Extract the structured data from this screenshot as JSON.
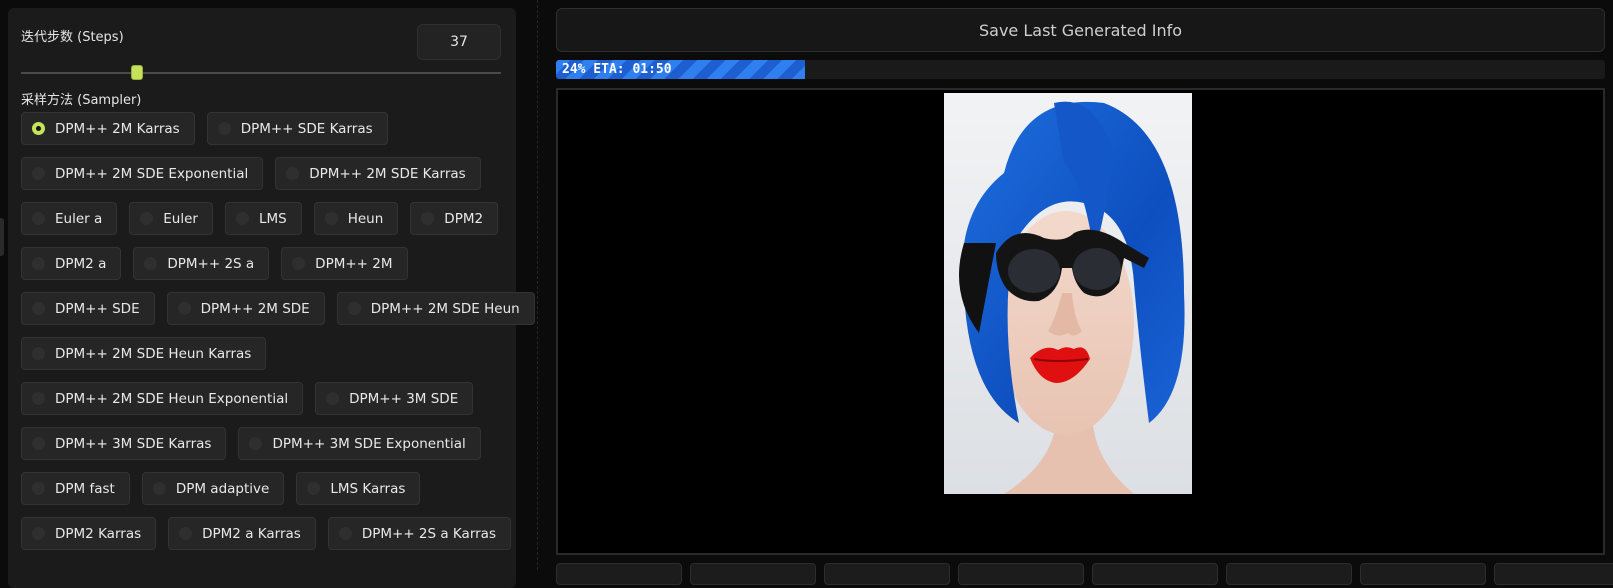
{
  "steps": {
    "label": "迭代步数 (Steps)",
    "value": "37",
    "min": 1,
    "max": 150
  },
  "sampler": {
    "label": "采样方法 (Sampler)",
    "selected": "DPM++ 2M Karras",
    "rows": [
      [
        "DPM++ 2M Karras",
        "DPM++ SDE Karras"
      ],
      [
        "DPM++ 2M SDE Exponential",
        "DPM++ 2M SDE Karras"
      ],
      [
        "Euler a",
        "Euler",
        "LMS",
        "Heun",
        "DPM2"
      ],
      [
        "DPM2 a",
        "DPM++ 2S a",
        "DPM++ 2M"
      ],
      [
        "DPM++ SDE",
        "DPM++ 2M SDE",
        "DPM++ 2M SDE Heun"
      ],
      [
        "DPM++ 2M SDE Heun Karras"
      ],
      [
        "DPM++ 2M SDE Heun Exponential",
        "DPM++ 3M SDE"
      ],
      [
        "DPM++ 3M SDE Karras",
        "DPM++ 3M SDE Exponential"
      ],
      [
        "DPM fast",
        "DPM adaptive",
        "LMS Karras"
      ],
      [
        "DPM2 Karras",
        "DPM2 a Karras",
        "DPM++ 2S a Karras"
      ]
    ]
  },
  "output": {
    "save_label": "Save Last Generated Info",
    "progress": {
      "text": "24% ETA: 01:50",
      "fraction": 0.237
    }
  },
  "colors": {
    "accent": "#c6e25a",
    "progress": "#2f7ff0"
  }
}
